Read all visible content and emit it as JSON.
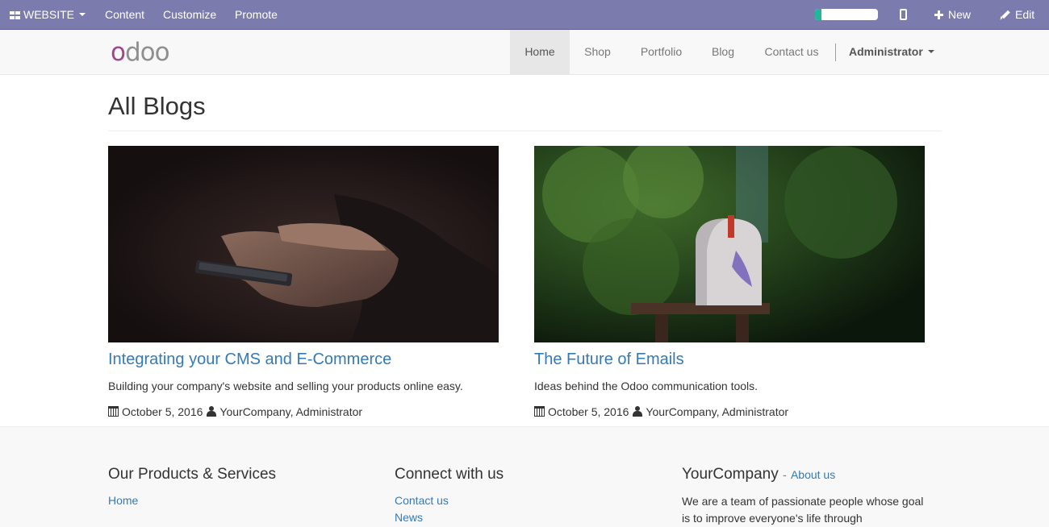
{
  "admin_bar": {
    "website_label": "WEBSITE",
    "menu": [
      "Content",
      "Customize",
      "Promote"
    ],
    "progress": 0.1,
    "new_label": "New",
    "edit_label": "Edit"
  },
  "navbar": {
    "logo_part1": "o",
    "logo_part2": "doo",
    "items": [
      "Home",
      "Shop",
      "Portfolio",
      "Blog",
      "Contact us"
    ],
    "active": "Home",
    "user": "Administrator"
  },
  "page": {
    "title": "All Blogs"
  },
  "posts": [
    {
      "title": "Integrating your CMS and E-Commerce",
      "subtitle": "Building your company's website and selling your products online easy.",
      "date": "October 5, 2016",
      "author": "YourCompany, Administrator"
    },
    {
      "title": "The Future of Emails",
      "subtitle": "Ideas behind the Odoo communication tools.",
      "date": "October 5, 2016",
      "author": "YourCompany, Administrator"
    }
  ],
  "footer": {
    "col1": {
      "heading": "Our Products & Services",
      "links": [
        "Home"
      ]
    },
    "col2": {
      "heading": "Connect with us",
      "links": [
        "Contact us",
        "News"
      ]
    },
    "col3": {
      "heading": "YourCompany",
      "dash": "-",
      "about_link": "About us",
      "text": "We are a team of passionate people whose goal is to improve everyone's life through"
    }
  },
  "colors": {
    "admin_bar": "#7c7bad",
    "link": "#337ab7",
    "logo_accent": "#a24689",
    "progress_fill": "#21b799"
  }
}
